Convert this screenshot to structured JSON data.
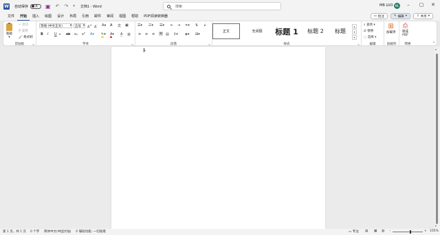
{
  "titlebar": {
    "autosave_label": "自动保存",
    "autosave_state": "关",
    "doc_title": "文档1 - Word",
    "search_placeholder": "搜索",
    "user_name": "MB LUO",
    "avatar_initials": "ML"
  },
  "menus": [
    "文件",
    "开始",
    "插入",
    "绘图",
    "设计",
    "布局",
    "引用",
    "邮件",
    "审阅",
    "视图",
    "帮助",
    "PDF阅读转换器"
  ],
  "active_menu": "开始",
  "right_buttons": {
    "comment": "批注",
    "edit": "编辑",
    "share": "共享"
  },
  "ribbon": {
    "clipboard": {
      "paste": "粘贴",
      "cut": "剪切",
      "copy": "复制",
      "format_painter": "格式刷",
      "label": "剪贴板"
    },
    "font": {
      "font_name": "等线 (中文正文)",
      "font_size": "五号",
      "label": "字体"
    },
    "paragraph": {
      "label": "段落"
    },
    "styles": {
      "items": [
        "正文",
        "无间隔",
        "标题 1",
        "标题 2",
        "标题"
      ],
      "label": "样式"
    },
    "editing": {
      "find": "查找",
      "replace": "替换",
      "select": "选择",
      "label": "编辑"
    },
    "addins": {
      "button": "加载项",
      "label": "加载项"
    },
    "convert": {
      "button_line1": "转成",
      "button_line2": "PDF",
      "label": "转换"
    }
  },
  "status": {
    "page": "第 1 页，共 1 页",
    "words": "0 个字",
    "language": "简体中文(中国大陆)",
    "accessibility": "辅助功能: 一切就绪",
    "focus": "专注",
    "zoom": "105%"
  },
  "colors": {
    "brand": "#2b579a",
    "highlight": "#f5e000",
    "font_color": "#e02020"
  }
}
